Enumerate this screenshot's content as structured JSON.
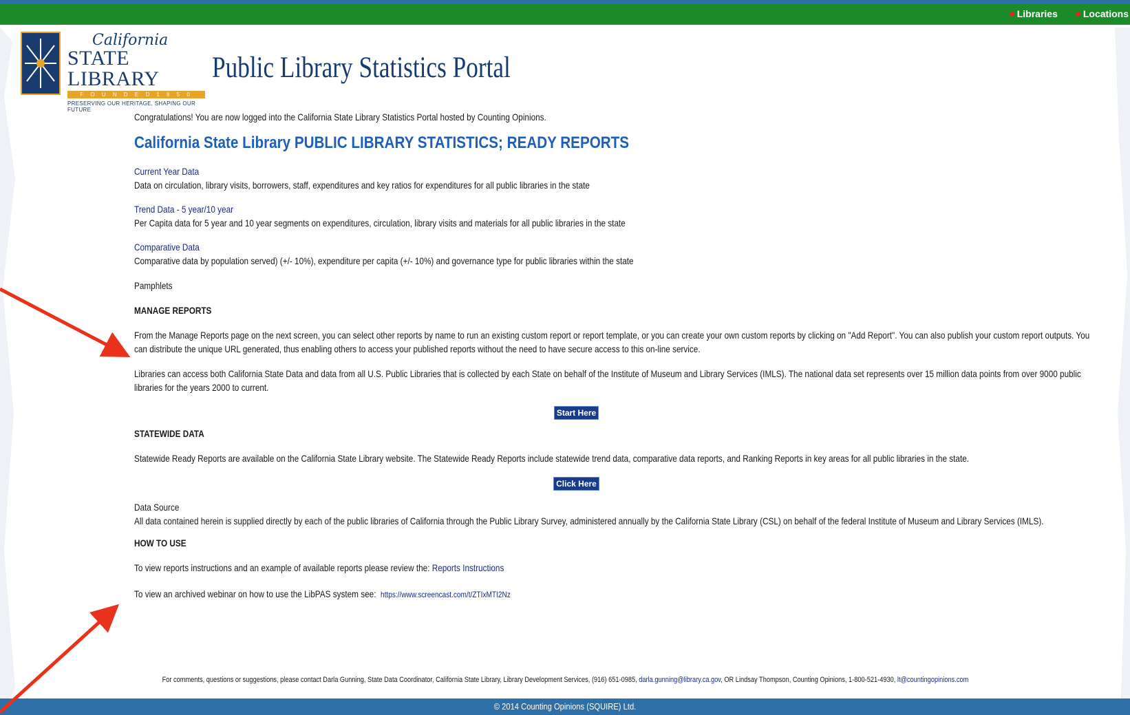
{
  "topnav": {
    "items": [
      {
        "label": "Libraries"
      },
      {
        "label": "Locations"
      }
    ]
  },
  "logo": {
    "california": "California",
    "statelibrary": "STATE LIBRARY",
    "founded": "F O U N D E D   1 8 5 0",
    "tagline": "PRESERVING OUR HERITAGE, SHAPING OUR FUTURE"
  },
  "header": {
    "title": "Public Library Statistics Portal"
  },
  "content": {
    "congrats": "Congratulations!  You are now logged into the California State Library Statistics Portal hosted by Counting Opinions.",
    "main_heading": "California State Library PUBLIC LIBRARY STATISTICS; READY REPORTS",
    "reports": [
      {
        "link": "Current Year Data",
        "desc": "Data on circulation, library visits, borrowers, staff, expenditures and key ratios for expenditures for all public libraries in the state"
      },
      {
        "link": "Trend Data - 5 year/10 year",
        "desc": "Per Capita data for 5 year and 10 year segments on expenditures, circulation, library visits and materials for all public libraries in the state"
      },
      {
        "link": "Comparative Data",
        "desc": "Comparative data by population served) (+/- 10%), expenditure per capita (+/- 10%) and governance type for public libraries within the state"
      }
    ],
    "pamphlets": "Pamphlets",
    "manage_heading": "MANAGE REPORTS",
    "manage_text": "From the Manage Reports page on the next screen, you can select other reports by name to run an existing custom report or report template, or you can create your own custom reports by clicking on \"Add Report\".  You can also publish your custom report outputs. You can distribute the unique URL generated, thus enabling others to access your published reports without the need to have secure access to this on-line service.",
    "libraries_text": "Libraries can access both California State Data and data from all U.S. Public Libraries that is collected by each State on behalf of the Institute of Museum and Library Services (IMLS).  The national data set represents over 15 million data points from over 9000 public libraries for the years 2000 to current.",
    "start_button": "Start Here",
    "statewide_heading": "STATEWIDE DATA",
    "statewide_text": "Statewide Ready Reports are available on the California State Library website. The Statewide Ready Reports include statewide trend data, comparative data reports, and Ranking Reports in key areas for all public libraries in the state.",
    "click_button": "Click Here",
    "datasource_heading": "Data Source",
    "datasource_text": "All data contained herein is supplied directly by each of the public libraries of California through the Public Library Survey, administered annually by the California State Library (CSL) on behalf of the federal Institute of Museum and Library Services (IMLS).",
    "howto_heading": "HOW TO USE",
    "howto_text1": "To view reports instructions and an example of available reports please review the:",
    "howto_link": "Reports Instructions",
    "howto_text2": "To view an archived webinar on how to use the LibPAS system see:",
    "howto_url": "https://www.screencast.com/t/ZTIxMTI2Nz"
  },
  "footer": {
    "contact_text": "For comments, questions or suggestions, please contact Darla Gunning, State Data Coordinator, California State Library, Library Development Services, (916) 651-0985,",
    "email1": "darla.gunning@library.ca.gov",
    "contact_or": ", OR Lindsay Thompson, Counting Opinions, 1-800-521-4930,",
    "email2": "lt@countingopinions.com",
    "copyright": "© 2014 Counting Opinions (SQUIRE) Ltd."
  },
  "colors": {
    "topbar": "#1c8a2b",
    "footer": "#2f6fa8",
    "heading": "#1f5fb8",
    "link": "#1a2a8c",
    "button": "#1a3b8a",
    "arrow": "#e8321c"
  }
}
